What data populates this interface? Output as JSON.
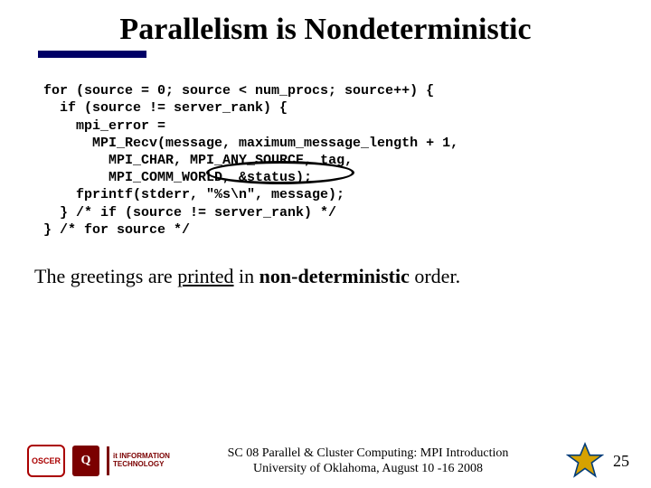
{
  "title": "Parallelism is Nondeterministic",
  "code": {
    "l1": "for (source = 0; source < num_procs; source++) {",
    "l2": "  if (source != server_rank) {",
    "l3": "    mpi_error =",
    "l4": "      MPI_Recv(message, maximum_message_length + 1,",
    "l5a": "        MPI_CHAR, ",
    "l5b": "MPI_ANY_SOURCE",
    "l5c": ", tag,",
    "l6": "        MPI_COMM_WORLD, &status);",
    "l7": "    fprintf(stderr, \"%s\\n\", message);",
    "l8": "  } /* if (source != server_rank) */",
    "l9": "} /* for source */"
  },
  "body": {
    "pre": "The greetings are ",
    "printed": "printed",
    "mid": " in ",
    "nondet": "non-deterministic",
    "post": " order."
  },
  "footer": {
    "line1": "SC 08 Parallel & Cluster Computing: MPI Introduction",
    "line2": "University of Oklahoma, August 10 -16 2008"
  },
  "logos": {
    "oscer": "OSCER",
    "ou": "Q",
    "it": "it INFORMATION TECHNOLOGY"
  },
  "page_number": "25"
}
